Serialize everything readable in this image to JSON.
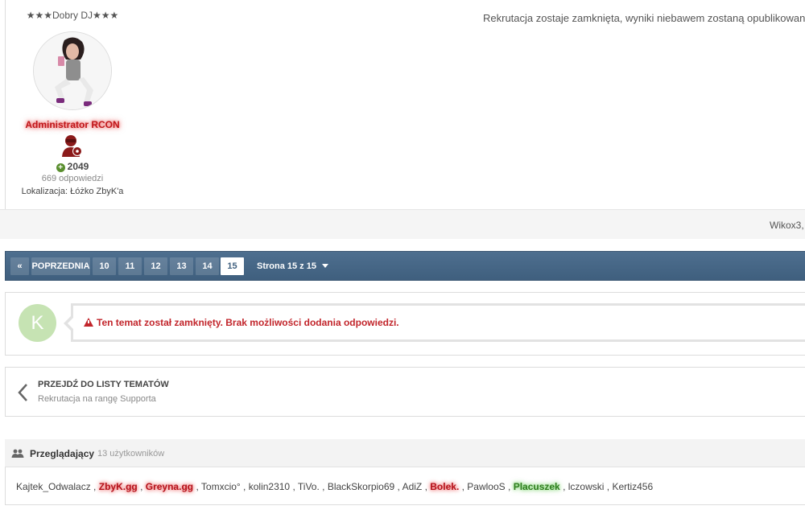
{
  "post": {
    "author_rank_title": "★★★Dobry DJ★★★",
    "group_name": "Administrator RCON",
    "reputation": "2049",
    "reply_count": "669 odpowiedzi",
    "location": "Lokalizacja: Łóżko ZbyK'a",
    "body_text": "Rekrutacja zostaje zamknięta, wyniki niebawem zostaną opublikowane.",
    "likers_text": "Wikox3,",
    "colors": {
      "group_glow": "#c0161a",
      "reputation_plus": "#5a8f2f"
    },
    "icons": {
      "avatar": "user-avatar-photo",
      "group": "admin-badge-icon",
      "reputation": "plus-circle-icon"
    }
  },
  "pagination": {
    "first_label": "«",
    "prev_label": "POPRZEDNIA",
    "pages": [
      "10",
      "11",
      "12",
      "13",
      "14",
      "15"
    ],
    "current_page": "15",
    "page_info": "Strona 15 z 15",
    "colors": {
      "bar": "#4e6f8f"
    }
  },
  "locked": {
    "avatar_letter": "K",
    "message": "Ten temat został zamknięty. Brak możliwości dodania odpowiedzi.",
    "colors": {
      "avatar_bg": "#c6e3b3",
      "message": "#c2252b"
    },
    "icons": {
      "warning": "warning-triangle-icon"
    }
  },
  "back_to_list": {
    "title": "PRZEJDŹ DO LISTY TEMATÓW",
    "subtitle": "Rekrutacja na rangę Supporta",
    "icons": {
      "chevron": "chevron-left-icon"
    }
  },
  "viewers": {
    "title": "Przeglądający",
    "count": "13 użytkowników",
    "icons": {
      "header": "users-icon"
    },
    "users": [
      {
        "name": "Kajtek_Odwalacz",
        "style": "normal"
      },
      {
        "name": "ZbyK.gg",
        "style": "red"
      },
      {
        "name": "Greyna.gg",
        "style": "red"
      },
      {
        "name": "Tomxcio°",
        "style": "normal"
      },
      {
        "name": "kolin2310",
        "style": "normal"
      },
      {
        "name": "TiVo.",
        "style": "normal"
      },
      {
        "name": "BlackSkorpio69",
        "style": "normal"
      },
      {
        "name": "AdiZ",
        "style": "normal"
      },
      {
        "name": "Bolek.",
        "style": "red"
      },
      {
        "name": "PawlooS",
        "style": "normal"
      },
      {
        "name": "Placuszek",
        "style": "green"
      },
      {
        "name": "lczowski",
        "style": "normal"
      },
      {
        "name": "Kertiz456",
        "style": "normal"
      }
    ]
  }
}
